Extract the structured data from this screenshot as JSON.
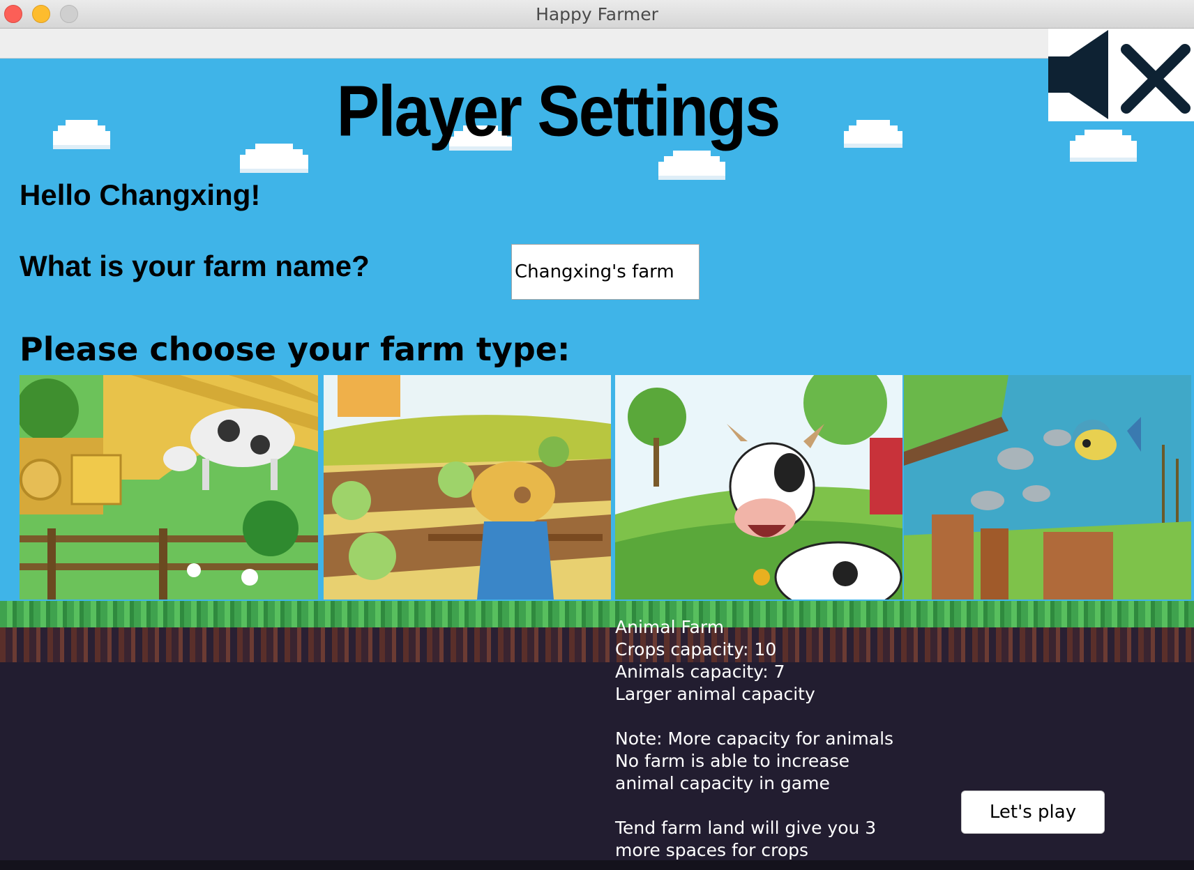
{
  "window": {
    "title": "Happy Farmer"
  },
  "header": {
    "title": "Player Settings",
    "mute_icon": "speaker-muted-icon"
  },
  "greeting": "Hello Changxing!",
  "farm_name": {
    "question": "What is your farm name?",
    "value": "Changxing's farm"
  },
  "farm_type": {
    "question": "Please choose your farm type:",
    "options": [
      {
        "image": "cow-grazing-farm-image"
      },
      {
        "image": "scarecrow-crop-farm-image"
      },
      {
        "image": "cartoon-cow-animal-farm-image"
      },
      {
        "image": "fish-pond-farm-image"
      }
    ]
  },
  "description": {
    "lines": [
      "Animal Farm",
      "Crops capacity: 10",
      "Animals capacity: 7",
      "Larger animal capacity",
      "",
      "Note: More capacity for animals",
      "No farm is able to increase",
      "animal capacity in game",
      "",
      "Tend farm land will give you 3",
      "more spaces for crops"
    ]
  },
  "buttons": {
    "play": "Let's play"
  },
  "colors": {
    "sky": "#3fb4e8",
    "grass": "#3fa24e",
    "ground": "#221d30"
  }
}
